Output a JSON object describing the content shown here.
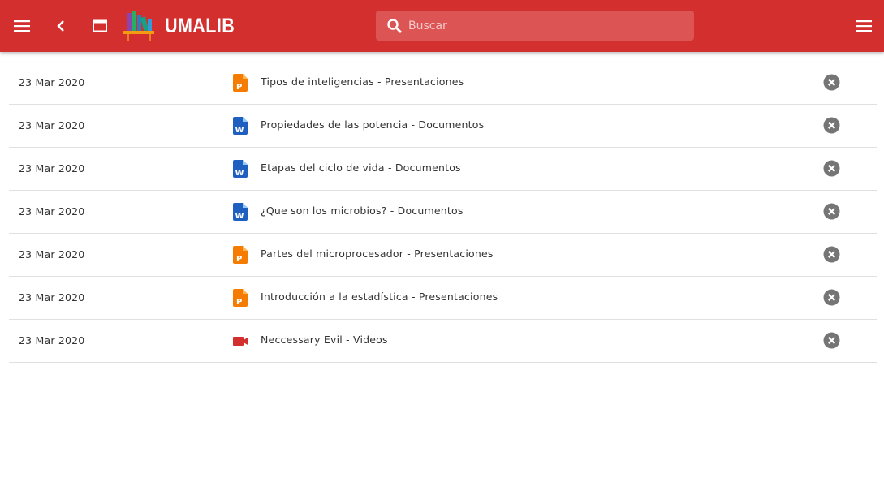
{
  "header": {
    "brand": "UMALIB",
    "menu_icon": "hamburger-menu-icon",
    "back_icon": "chevron-left-icon",
    "window_icon": "window-icon",
    "logo": "books-shelf-logo",
    "right_menu_icon": "hamburger-menu-icon",
    "background_color": "#d32f2f"
  },
  "search": {
    "placeholder": "Buscar",
    "value": "",
    "icon": "search-icon"
  },
  "history": [
    {
      "date": "23 Mar 2020",
      "type": "presentation",
      "icon": "presentation-file-icon",
      "title": "Tipos de inteligencias - Presentaciones"
    },
    {
      "date": "23 Mar 2020",
      "type": "document",
      "icon": "word-document-icon",
      "title": "Propiedades de las potencia - Documentos"
    },
    {
      "date": "23 Mar 2020",
      "type": "document",
      "icon": "word-document-icon",
      "title": "Etapas del ciclo de vida - Documentos"
    },
    {
      "date": "23 Mar 2020",
      "type": "document",
      "icon": "word-document-icon",
      "title": "¿Que son los microbios? - Documentos"
    },
    {
      "date": "23 Mar 2020",
      "type": "presentation",
      "icon": "presentation-file-icon",
      "title": "Partes del microprocesador - Presentaciones"
    },
    {
      "date": "23 Mar 2020",
      "type": "presentation",
      "icon": "presentation-file-icon",
      "title": "Introducción a la estadística - Presentaciones"
    },
    {
      "date": "23 Mar 2020",
      "type": "video",
      "icon": "video-camera-icon",
      "title": "Neccessary Evil - Videos"
    }
  ],
  "colors": {
    "presentation": "#f57c00",
    "document": "#1e5fbf",
    "video": "#d32f2f",
    "remove": "#757575"
  }
}
